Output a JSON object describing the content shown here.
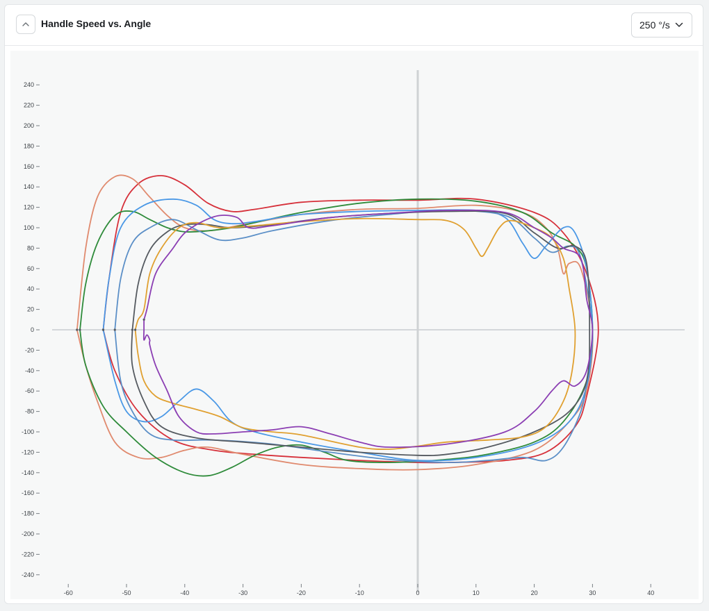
{
  "header": {
    "title": "Handle Speed vs. Angle",
    "scale_select": {
      "selected": "250 °/s"
    }
  },
  "chart_data": {
    "type": "line",
    "title": "Handle Speed vs. Angle",
    "xlabel": "",
    "ylabel": "",
    "xlim": [
      -60,
      45
    ],
    "ylim": [
      -250,
      250
    ],
    "x_ticks": [
      -60,
      -50,
      -40,
      -30,
      -20,
      -10,
      0,
      10,
      20,
      30,
      40
    ],
    "y_ticks": [
      240,
      220,
      200,
      180,
      160,
      140,
      120,
      100,
      80,
      60,
      40,
      20,
      0,
      -20,
      -40,
      -60,
      -80,
      -100,
      -120,
      -140,
      -160,
      -180,
      -200,
      -220,
      -240
    ],
    "grid": false,
    "legend": "none",
    "series": [
      {
        "color": "#d6303a",
        "points": [
          [
            -54,
            0
          ],
          [
            -53,
            50
          ],
          [
            -51,
            115
          ],
          [
            -48,
            143
          ],
          [
            -44,
            151
          ],
          [
            -40,
            142
          ],
          [
            -36,
            124
          ],
          [
            -32,
            116
          ],
          [
            -28,
            118
          ],
          [
            -20,
            125
          ],
          [
            -10,
            127
          ],
          [
            0,
            127
          ],
          [
            10,
            128
          ],
          [
            20,
            115
          ],
          [
            25,
            95
          ],
          [
            29,
            55
          ],
          [
            31,
            0
          ],
          [
            29,
            -65
          ],
          [
            27,
            -95
          ],
          [
            22,
            -120
          ],
          [
            15,
            -128
          ],
          [
            5,
            -130
          ],
          [
            0,
            -130
          ],
          [
            -10,
            -128
          ],
          [
            -20,
            -125
          ],
          [
            -28,
            -122
          ],
          [
            -35,
            -118
          ],
          [
            -42,
            -108
          ],
          [
            -48,
            -80
          ],
          [
            -52,
            -40
          ],
          [
            -54,
            0
          ]
        ]
      },
      {
        "color": "#e08a6e",
        "points": [
          [
            -58.5,
            0
          ],
          [
            -57,
            80
          ],
          [
            -55,
            130
          ],
          [
            -52,
            150
          ],
          [
            -49,
            148
          ],
          [
            -46,
            130
          ],
          [
            -43,
            112
          ],
          [
            -40,
            100
          ],
          [
            -36,
            97
          ],
          [
            -30,
            103
          ],
          [
            -20,
            113
          ],
          [
            -10,
            118
          ],
          [
            0,
            119
          ],
          [
            10,
            122
          ],
          [
            18,
            115
          ],
          [
            22,
            100
          ],
          [
            24,
            80
          ],
          [
            25,
            55
          ],
          [
            26,
            65
          ],
          [
            28,
            60
          ],
          [
            30,
            0
          ],
          [
            29,
            -60
          ],
          [
            26,
            -90
          ],
          [
            20,
            -118
          ],
          [
            10,
            -132
          ],
          [
            0,
            -137
          ],
          [
            -10,
            -136
          ],
          [
            -20,
            -132
          ],
          [
            -30,
            -122
          ],
          [
            -36,
            -115
          ],
          [
            -40,
            -118
          ],
          [
            -44,
            -125
          ],
          [
            -48,
            -125
          ],
          [
            -52,
            -110
          ],
          [
            -55,
            -70
          ],
          [
            -57,
            -35
          ],
          [
            -58.5,
            0
          ]
        ]
      },
      {
        "color": "#2e8b3a",
        "points": [
          [
            -58,
            0
          ],
          [
            -57,
            45
          ],
          [
            -55,
            85
          ],
          [
            -52,
            112
          ],
          [
            -49,
            116
          ],
          [
            -46,
            108
          ],
          [
            -43,
            100
          ],
          [
            -40,
            96
          ],
          [
            -36,
            97
          ],
          [
            -32,
            100
          ],
          [
            -28,
            105
          ],
          [
            -20,
            115
          ],
          [
            -10,
            124
          ],
          [
            0,
            128
          ],
          [
            10,
            126
          ],
          [
            18,
            115
          ],
          [
            23,
            95
          ],
          [
            27,
            82
          ],
          [
            29,
            60
          ],
          [
            30,
            0
          ],
          [
            29,
            -50
          ],
          [
            25,
            -90
          ],
          [
            20,
            -110
          ],
          [
            12,
            -122
          ],
          [
            5,
            -127
          ],
          [
            -5,
            -130
          ],
          [
            -12,
            -128
          ],
          [
            -16,
            -120
          ],
          [
            -20,
            -113
          ],
          [
            -24,
            -115
          ],
          [
            -28,
            -123
          ],
          [
            -32,
            -135
          ],
          [
            -36,
            -143
          ],
          [
            -40,
            -140
          ],
          [
            -45,
            -125
          ],
          [
            -50,
            -100
          ],
          [
            -54,
            -75
          ],
          [
            -57,
            -35
          ],
          [
            -58,
            0
          ]
        ]
      },
      {
        "color": "#4a98e6",
        "points": [
          [
            -54,
            0
          ],
          [
            -53,
            50
          ],
          [
            -51,
            100
          ],
          [
            -47,
            122
          ],
          [
            -42,
            128
          ],
          [
            -38,
            122
          ],
          [
            -35,
            108
          ],
          [
            -32,
            104
          ],
          [
            -28,
            106
          ],
          [
            -20,
            113
          ],
          [
            -10,
            116
          ],
          [
            0,
            117
          ],
          [
            10,
            117
          ],
          [
            15,
            110
          ],
          [
            18,
            85
          ],
          [
            20,
            70
          ],
          [
            22,
            82
          ],
          [
            25,
            100
          ],
          [
            27,
            95
          ],
          [
            29,
            60
          ],
          [
            30,
            0
          ],
          [
            29,
            -55
          ],
          [
            26,
            -90
          ],
          [
            20,
            -112
          ],
          [
            10,
            -125
          ],
          [
            0,
            -128
          ],
          [
            -10,
            -120
          ],
          [
            -20,
            -110
          ],
          [
            -28,
            -100
          ],
          [
            -32,
            -90
          ],
          [
            -35,
            -70
          ],
          [
            -38,
            -58
          ],
          [
            -41,
            -70
          ],
          [
            -44,
            -85
          ],
          [
            -47,
            -90
          ],
          [
            -50,
            -80
          ],
          [
            -52,
            -50
          ],
          [
            -54,
            0
          ]
        ]
      },
      {
        "color": "#5b8fc7",
        "points": [
          [
            -52,
            0
          ],
          [
            -51,
            50
          ],
          [
            -49,
            85
          ],
          [
            -46,
            100
          ],
          [
            -42,
            108
          ],
          [
            -38,
            98
          ],
          [
            -34,
            88
          ],
          [
            -30,
            90
          ],
          [
            -25,
            97
          ],
          [
            -15,
            107
          ],
          [
            -5,
            113
          ],
          [
            5,
            117
          ],
          [
            15,
            112
          ],
          [
            20,
            90
          ],
          [
            23,
            76
          ],
          [
            26,
            82
          ],
          [
            28,
            70
          ],
          [
            30,
            0
          ],
          [
            29,
            -50
          ],
          [
            28,
            -80
          ],
          [
            25,
            -115
          ],
          [
            22,
            -128
          ],
          [
            18,
            -125
          ],
          [
            12,
            -128
          ],
          [
            5,
            -130
          ],
          [
            -5,
            -127
          ],
          [
            -15,
            -120
          ],
          [
            -25,
            -112
          ],
          [
            -35,
            -108
          ],
          [
            -42,
            -108
          ],
          [
            -46,
            -102
          ],
          [
            -49,
            -80
          ],
          [
            -51,
            -50
          ],
          [
            -52,
            0
          ]
        ]
      },
      {
        "color": "#555a60",
        "points": [
          [
            -49,
            0
          ],
          [
            -48,
            45
          ],
          [
            -46,
            78
          ],
          [
            -43,
            96
          ],
          [
            -40,
            103
          ],
          [
            -36,
            103
          ],
          [
            -32,
            100
          ],
          [
            -25,
            103
          ],
          [
            -15,
            110
          ],
          [
            -5,
            114
          ],
          [
            5,
            116
          ],
          [
            15,
            114
          ],
          [
            20,
            95
          ],
          [
            24,
            80
          ],
          [
            27,
            82
          ],
          [
            29,
            65
          ],
          [
            29.5,
            0
          ],
          [
            29,
            -50
          ],
          [
            26,
            -80
          ],
          [
            20,
            -100
          ],
          [
            12,
            -115
          ],
          [
            5,
            -122
          ],
          [
            0,
            -123
          ],
          [
            -10,
            -120
          ],
          [
            -20,
            -115
          ],
          [
            -30,
            -110
          ],
          [
            -38,
            -106
          ],
          [
            -44,
            -95
          ],
          [
            -47,
            -70
          ],
          [
            -49,
            -35
          ],
          [
            -49,
            0
          ]
        ]
      },
      {
        "color": "#e0a030",
        "points": [
          [
            -48.5,
            0
          ],
          [
            -48,
            10
          ],
          [
            -47,
            20
          ],
          [
            -46,
            55
          ],
          [
            -44,
            80
          ],
          [
            -41,
            100
          ],
          [
            -38,
            105
          ],
          [
            -34,
            100
          ],
          [
            -28,
            102
          ],
          [
            -20,
            106
          ],
          [
            -10,
            109
          ],
          [
            0,
            108
          ],
          [
            5,
            107
          ],
          [
            8,
            98
          ],
          [
            10,
            80
          ],
          [
            11,
            72
          ],
          [
            12,
            80
          ],
          [
            14,
            100
          ],
          [
            16,
            107
          ],
          [
            20,
            100
          ],
          [
            23,
            90
          ],
          [
            25,
            70
          ],
          [
            26,
            40
          ],
          [
            27,
            0
          ],
          [
            26.5,
            -40
          ],
          [
            25,
            -70
          ],
          [
            22,
            -95
          ],
          [
            18,
            -105
          ],
          [
            12,
            -108
          ],
          [
            5,
            -110
          ],
          [
            0,
            -114
          ],
          [
            -5,
            -117
          ],
          [
            -10,
            -115
          ],
          [
            -20,
            -103
          ],
          [
            -25,
            -100
          ],
          [
            -30,
            -96
          ],
          [
            -34,
            -85
          ],
          [
            -38,
            -78
          ],
          [
            -42,
            -72
          ],
          [
            -45,
            -65
          ],
          [
            -47,
            -50
          ],
          [
            -48,
            -25
          ],
          [
            -48.5,
            0
          ]
        ]
      },
      {
        "color": "#8b3eb3",
        "points": [
          [
            -47,
            10
          ],
          [
            -46.5,
            20
          ],
          [
            -45,
            55
          ],
          [
            -42,
            80
          ],
          [
            -40,
            95
          ],
          [
            -37,
            106
          ],
          [
            -34,
            112
          ],
          [
            -31,
            110
          ],
          [
            -29,
            100
          ],
          [
            -25,
            102
          ],
          [
            -15,
            110
          ],
          [
            -5,
            114
          ],
          [
            5,
            117
          ],
          [
            15,
            115
          ],
          [
            20,
            100
          ],
          [
            23,
            90
          ],
          [
            25,
            80
          ],
          [
            28,
            70
          ],
          [
            29,
            30
          ],
          [
            30,
            0
          ],
          [
            29,
            -40
          ],
          [
            27,
            -55
          ],
          [
            25,
            -50
          ],
          [
            23,
            -60
          ],
          [
            20,
            -80
          ],
          [
            15,
            -100
          ],
          [
            5,
            -112
          ],
          [
            -5,
            -115
          ],
          [
            -10,
            -110
          ],
          [
            -15,
            -102
          ],
          [
            -20,
            -95
          ],
          [
            -25,
            -98
          ],
          [
            -30,
            -100
          ],
          [
            -35,
            -102
          ],
          [
            -38,
            -100
          ],
          [
            -41,
            -85
          ],
          [
            -43,
            -60
          ],
          [
            -45,
            -35
          ],
          [
            -46,
            -15
          ],
          [
            -46,
            -10
          ],
          [
            -46.5,
            -5
          ],
          [
            -47,
            -10
          ],
          [
            -47,
            0
          ],
          [
            -47,
            10
          ]
        ]
      }
    ]
  }
}
